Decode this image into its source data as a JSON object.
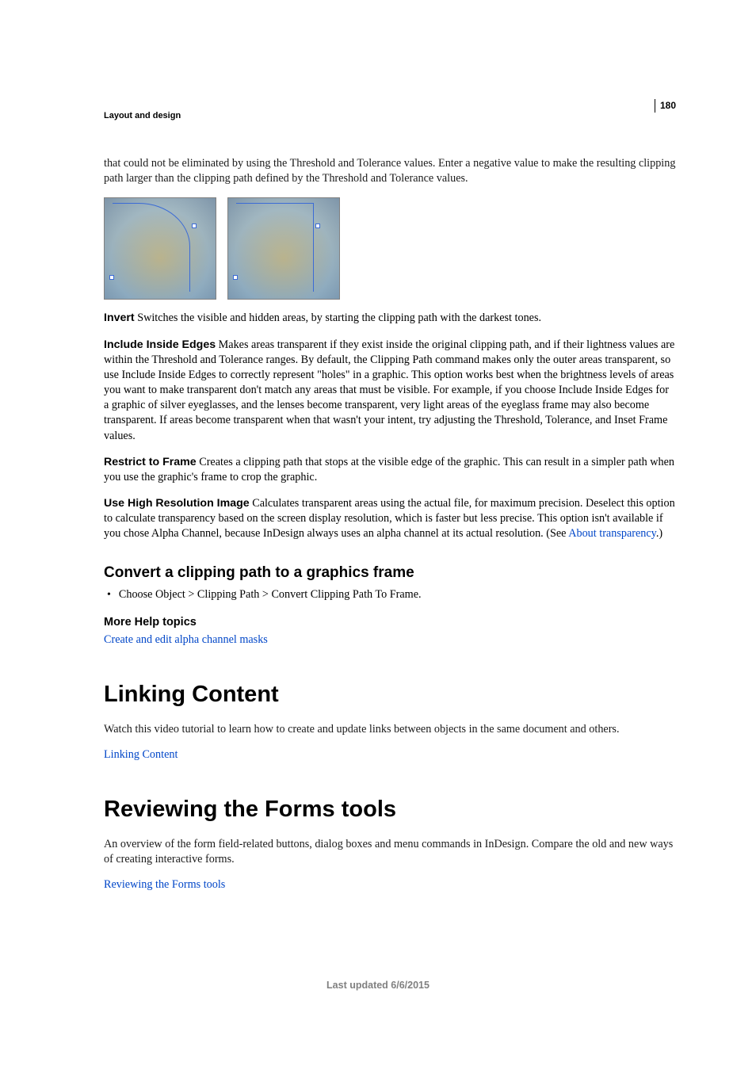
{
  "page": {
    "number": "180",
    "section": "Layout and design",
    "footer": "Last updated 6/6/2015"
  },
  "intro": "that could not be eliminated by using the Threshold and Tolerance values. Enter a negative value to make the resulting clipping path larger than the clipping path defined by the Threshold and Tolerance values.",
  "terms": {
    "invert_label": "Invert",
    "invert_text": "  Switches the visible and hidden areas, by starting the clipping path with the darkest tones.",
    "inside_label": "Include Inside Edges",
    "inside_text": "  Makes areas transparent if they exist inside the original clipping path, and if their lightness values are within the Threshold and Tolerance ranges. By default, the Clipping Path command makes only the outer areas transparent, so use Include Inside Edges to correctly represent \"holes\" in a graphic. This option works best when the brightness levels of areas you want to make transparent don't match any areas that must be visible. For example, if you choose Include Inside Edges for a graphic of silver eyeglasses, and the lenses become transparent, very light areas of the eyeglass frame may also become transparent. If areas become transparent when that wasn't your intent, try adjusting the Threshold, Tolerance, and Inset Frame values.",
    "restrict_label": "Restrict to Frame",
    "restrict_text": "  Creates a clipping path that stops at the visible edge of the graphic. This can result in a simpler path when you use the graphic's frame to crop the graphic.",
    "highres_label": "Use High Resolution Image",
    "highres_text_a": "  Calculates transparent areas using the actual file, for maximum precision. Deselect this option to calculate transparency based on the screen display resolution, which is faster but less precise. This option isn't available if you chose Alpha Channel, because InDesign always uses an alpha channel at its actual resolution. (See ",
    "highres_link": "About transparency",
    "highres_text_b": ".)"
  },
  "convert": {
    "heading": "Convert a clipping path to a graphics frame",
    "bullet": "Choose Object > Clipping Path > Convert Clipping Path To Frame."
  },
  "more_help": {
    "heading": "More Help topics",
    "link": "Create and edit alpha channel masks"
  },
  "linking": {
    "heading": "Linking Content",
    "para": "Watch this video tutorial to learn how to create and update links between objects in the same document and others.",
    "link": "Linking Content"
  },
  "reviewing": {
    "heading": "Reviewing the Forms tools",
    "para": "An overview of the form field-related buttons, dialog boxes and menu commands in InDesign. Compare the old and new ways of creating interactive forms.",
    "link": "Reviewing the Forms tools"
  }
}
